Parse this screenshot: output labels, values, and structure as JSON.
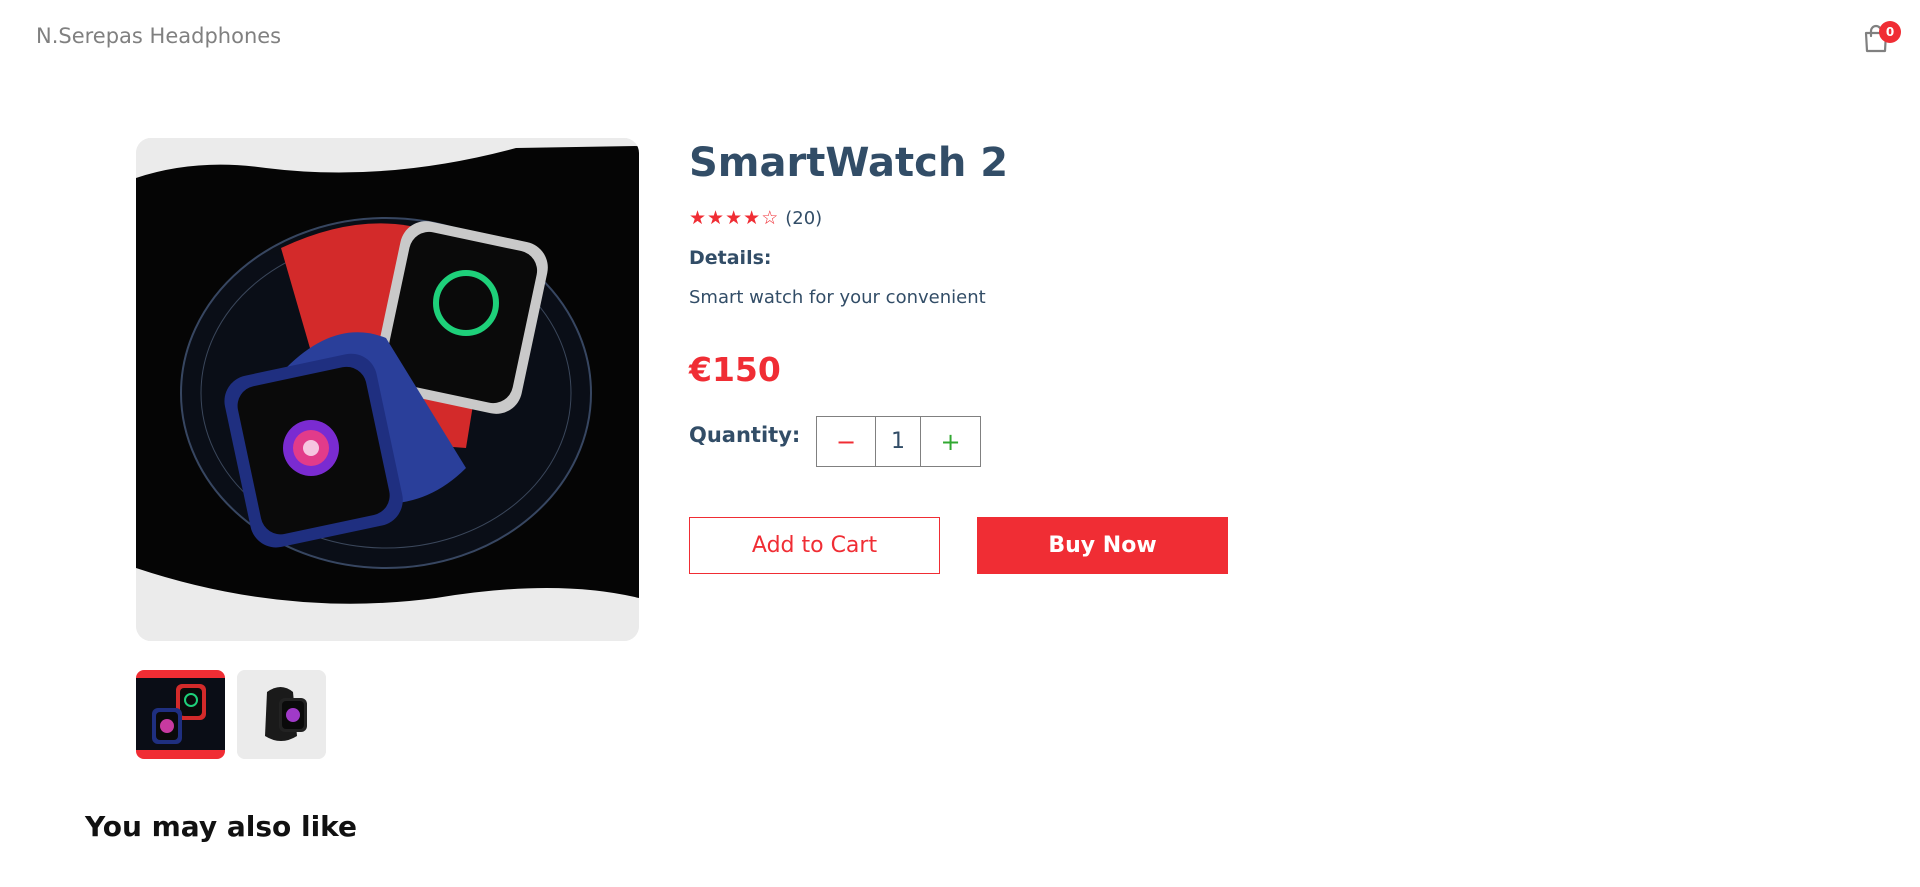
{
  "navbar": {
    "logo": "N.Serepas Headphones",
    "cart_count": "0"
  },
  "product": {
    "title": "SmartWatch 2",
    "rating_stars": 4,
    "rating_max": 5,
    "rating_count": "(20)",
    "details_label": "Details:",
    "description": "Smart watch for your convenient",
    "price": "€150",
    "quantity_label": "Quantity:",
    "quantity": "1",
    "minus_symbol": "−",
    "plus_symbol": "+",
    "add_to_cart": "Add to Cart",
    "buy_now": "Buy Now"
  },
  "recommendations": {
    "heading": "You may also like"
  },
  "colors": {
    "accent": "#f02d34",
    "text": "#324d67",
    "plus": "#31a831"
  },
  "icons": {
    "cart": "shopping-bag-icon",
    "star_filled": "star-filled-icon",
    "star_empty": "star-outline-icon"
  }
}
